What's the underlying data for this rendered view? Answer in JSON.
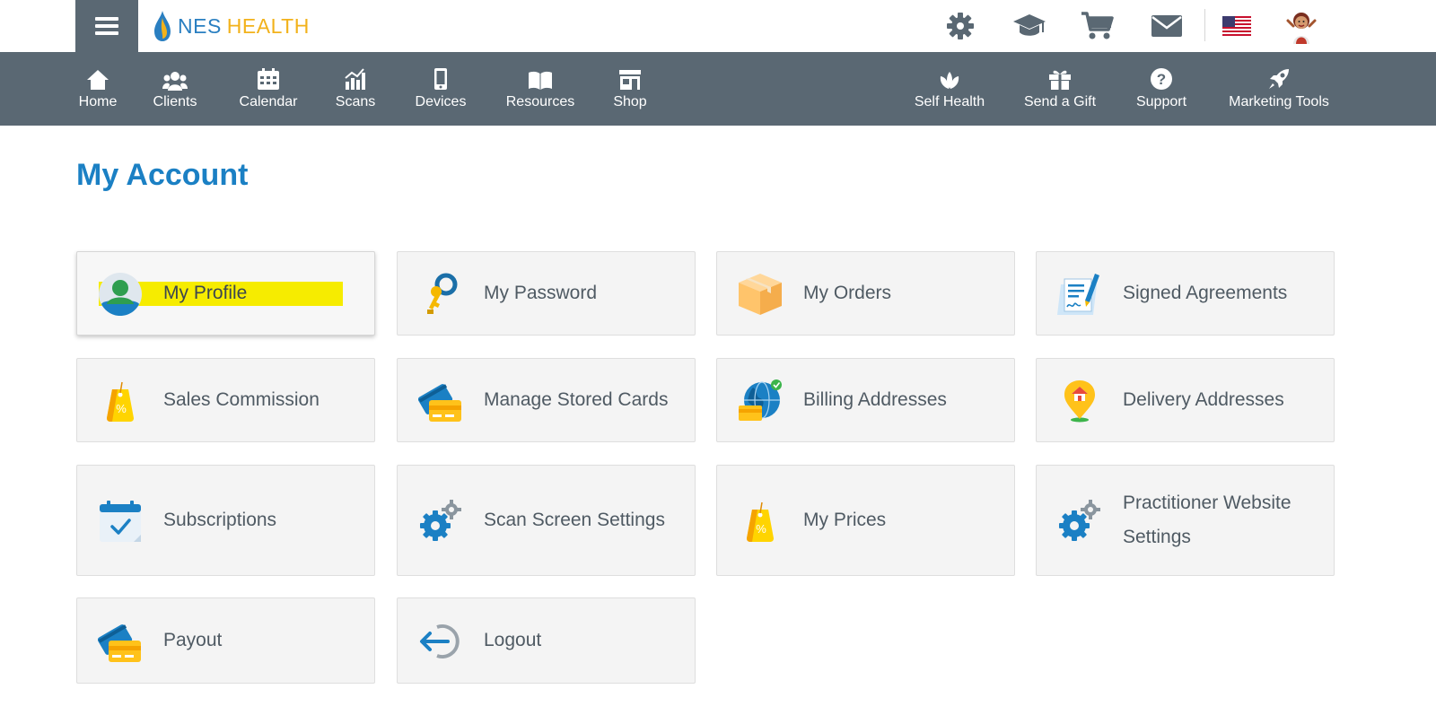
{
  "brand": {
    "part1": "NES",
    "part2": "HEALTH"
  },
  "top_icons": [
    "gear-icon",
    "graduation-cap-icon",
    "cart-icon",
    "mail-icon",
    "us-flag-icon",
    "avatar"
  ],
  "nav": {
    "left": [
      {
        "label": "Home",
        "icon": "home-icon"
      },
      {
        "label": "Clients",
        "icon": "clients-icon"
      },
      {
        "label": "Calendar",
        "icon": "calendar-icon"
      },
      {
        "label": "Scans",
        "icon": "scans-icon"
      },
      {
        "label": "Devices",
        "icon": "device-icon"
      },
      {
        "label": "Resources",
        "icon": "book-icon"
      },
      {
        "label": "Shop",
        "icon": "shop-icon"
      }
    ],
    "right": [
      {
        "label": "Self Health",
        "icon": "lotus-icon"
      },
      {
        "label": "Send a Gift",
        "icon": "gift-icon"
      },
      {
        "label": "Support",
        "icon": "question-icon"
      },
      {
        "label": "Marketing Tools",
        "icon": "rocket-icon"
      }
    ]
  },
  "page": {
    "title": "My Account"
  },
  "tiles": [
    {
      "label": "My Profile",
      "icon": "profile-icon",
      "highlighted": true
    },
    {
      "label": "My Password",
      "icon": "keys-icon"
    },
    {
      "label": "My Orders",
      "icon": "box-icon"
    },
    {
      "label": "Signed Agreements",
      "icon": "signed-document-icon"
    },
    {
      "label": "Sales Commission",
      "icon": "price-tag-icon"
    },
    {
      "label": "Manage Stored Cards",
      "icon": "credit-cards-icon"
    },
    {
      "label": "Billing Addresses",
      "icon": "globe-card-icon"
    },
    {
      "label": "Delivery Addresses",
      "icon": "location-pin-icon"
    },
    {
      "label": "Subscriptions",
      "icon": "calendar-check-icon"
    },
    {
      "label": "Scan Screen Settings",
      "icon": "gears-icon"
    },
    {
      "label": "My Prices",
      "icon": "price-tag-icon"
    },
    {
      "label": "Practitioner Website Settings",
      "icon": "gears-icon"
    },
    {
      "label": "Payout",
      "icon": "credit-cards-icon"
    },
    {
      "label": "Logout",
      "icon": "logout-icon"
    }
  ],
  "colors": {
    "nav_bg": "#5a6873",
    "title_blue": "#1b80c4",
    "tile_bg": "#f4f4f4",
    "highlight": "#f6ec00"
  }
}
